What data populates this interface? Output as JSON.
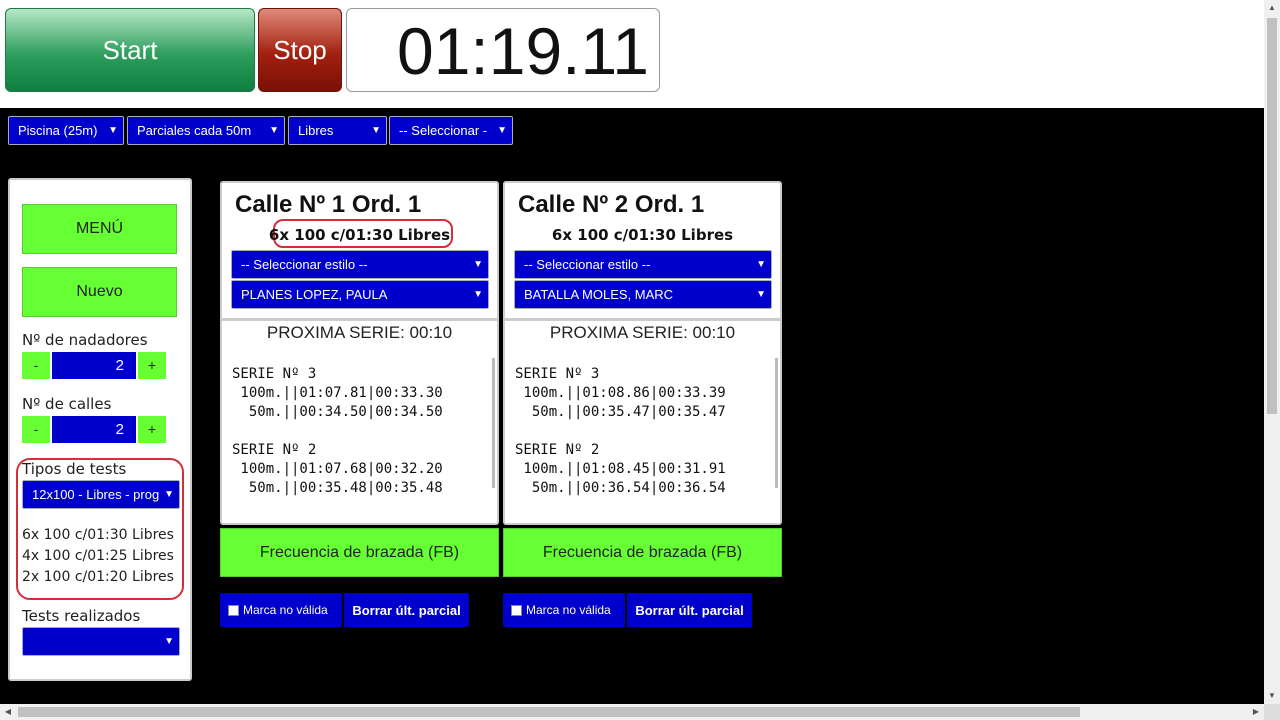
{
  "controls": {
    "start_label": "Start",
    "stop_label": "Stop",
    "timer": "01:19.11"
  },
  "filters": {
    "pool": "Piscina (25m)",
    "splits": "Parciales cada 50m",
    "style": "Libres",
    "select": "-- Seleccionar -"
  },
  "sidebar": {
    "menu_label": "MENÚ",
    "new_label": "Nuevo",
    "swimmers_label": "Nº de nadadores",
    "swimmers_value": "2",
    "lanes_label": "Nº de calles",
    "lanes_value": "2",
    "minus": "-",
    "plus": "+",
    "test_types_label": "Tipos de tests",
    "test_type_selected": "12x100 - Libres - prog",
    "test_lines": [
      "6x 100 c/01:30 Libres",
      "4x 100 c/01:25 Libres",
      "2x 100 c/01:20 Libres"
    ],
    "done_tests_label": "Tests realizados",
    "done_tests_selected": ""
  },
  "lanes": [
    {
      "title": "Calle Nº 1 Ord. 1",
      "set": "6x 100 c/01:30 Libres",
      "style_select": "-- Seleccionar estilo --",
      "swimmer": "PLANES LOPEZ, PAULA",
      "next_series": "PROXIMA SERIE: 00:10",
      "log": "SERIE Nº 3\n 100m.||01:07.81|00:33.30\n  50m.||00:34.50|00:34.50\n\nSERIE Nº 2\n 100m.||01:07.68|00:32.20\n  50m.||00:35.48|00:35.48",
      "fb_label": "Frecuencia de brazada (FB)",
      "invalid_label": "Marca no válida",
      "delete_label": "Borrar últ. parcial"
    },
    {
      "title": "Calle Nº 2 Ord. 1",
      "set": "6x 100 c/01:30 Libres",
      "style_select": "-- Seleccionar estilo --",
      "swimmer": "BATALLA MOLES, MARC",
      "next_series": "PROXIMA SERIE: 00:10",
      "log": "SERIE Nº 3\n 100m.||01:08.86|00:33.39\n  50m.||00:35.47|00:35.47\n\nSERIE Nº 2\n 100m.||01:08.45|00:31.91\n  50m.||00:36.54|00:36.54",
      "fb_label": "Frecuencia de brazada (FB)",
      "invalid_label": "Marca no válida",
      "delete_label": "Borrar últ. parcial"
    }
  ],
  "icons": {
    "dropdown": "dropdown-arrow-icon",
    "checkbox": "checkbox-icon"
  },
  "colors": {
    "start_green": "#2f9e5e",
    "stop_red": "#a2200f",
    "accent_blue": "#0000cc",
    "action_green": "#66ff33",
    "highlight_red": "#d32f3a"
  }
}
